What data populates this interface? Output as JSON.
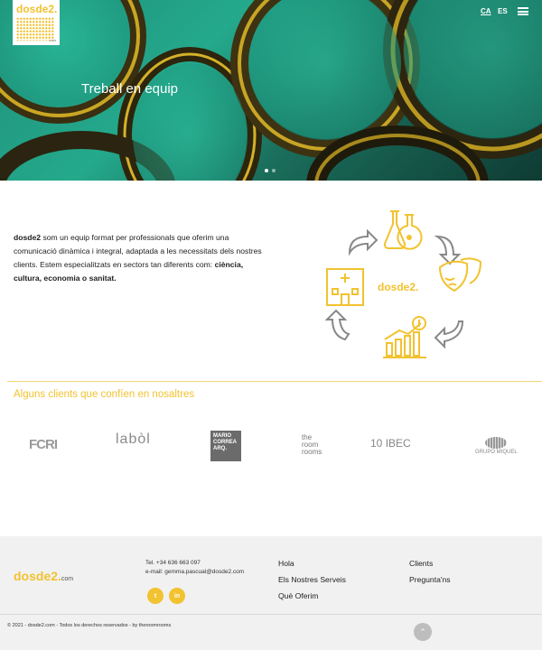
{
  "header": {
    "logo": {
      "brand": "dosde2.",
      "suffix": "com"
    },
    "languages": [
      "CA",
      "ES"
    ],
    "active_language": "CA",
    "menu_icon": "hamburger-menu-icon"
  },
  "hero": {
    "title": "Treball en equip",
    "slides": 2,
    "active_slide": 1
  },
  "intro": {
    "brand": "dosde2",
    "text": " som un equip format per professionals que oferim una comunicació dinàmica i integral, adaptada a les necessitats dels nostres clients. Estem especialitzats en sectors tan diferents com: ",
    "sectors": "ciència, cultura, economia o sanitat.",
    "graphic_center": "dosde2.",
    "graphic_icons": [
      "flasks-icon",
      "theater-masks-icon",
      "growth-chart-dollar-icon",
      "hospital-icon",
      "cycle-arrow-icon"
    ]
  },
  "clients": {
    "title": "Alguns clients que confíen en nosaltres",
    "logos": {
      "fcri": "FCRI",
      "labol": "labòl",
      "mario": "MARIO CORREA ARQ.",
      "room": [
        "the",
        "room",
        "rooms"
      ],
      "ibec": "IBEC",
      "grupo": "GRUPO MIQUEL"
    },
    "brand_color": "#f2c230"
  },
  "footer": {
    "brand": "dosde2.",
    "brand_suffix": "com",
    "tel": "Tel. +34 636 663 097",
    "email": "e-mail: gemma.pascual@dosde2.com",
    "social": [
      "twitter-icon",
      "linkedin-icon"
    ],
    "nav_col1": [
      "Hola",
      "Els Nostres Serveis",
      "Què Oferim"
    ],
    "nav_col2": [
      "Clients",
      "Pregunta'ns"
    ],
    "copyright": "© 2021 - dosde2.com - Todos los derechos reservados - by theroomrooms",
    "to_top_icon": "chevron-up-icon"
  }
}
